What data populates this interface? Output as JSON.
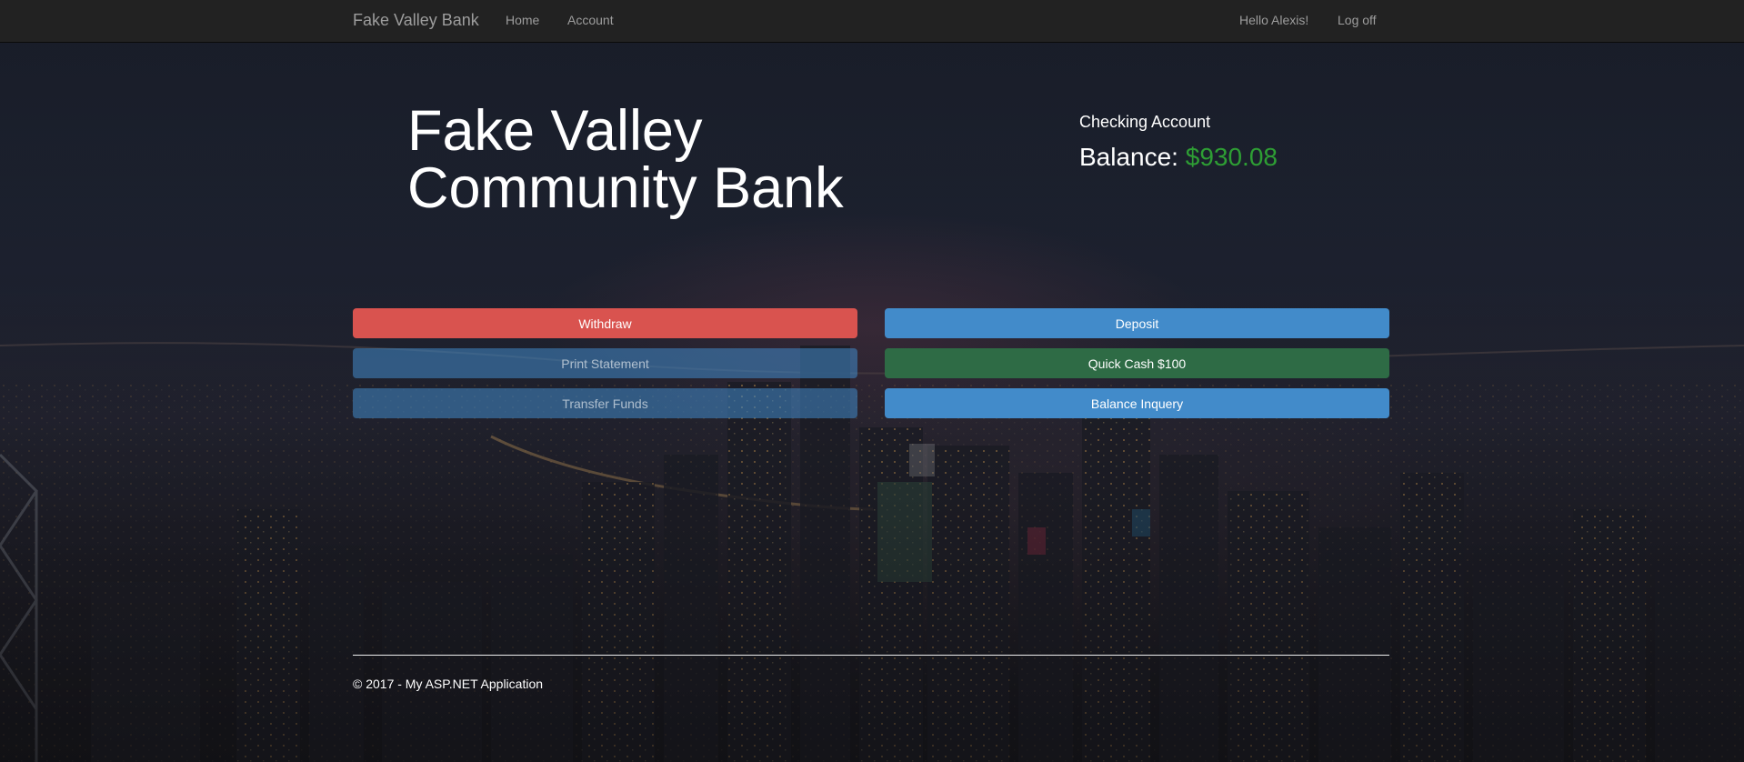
{
  "navbar": {
    "brand": "Fake Valley Bank",
    "links": [
      {
        "label": "Home"
      },
      {
        "label": "Account"
      }
    ],
    "greeting": "Hello Alexis!",
    "logoff": "Log off"
  },
  "hero": {
    "title_line1": "Fake Valley",
    "title_line2": "Community Bank"
  },
  "account": {
    "type": "Checking Account",
    "balance_label": "Balance:",
    "balance_value": "$930.08",
    "balance_color": "#2e9e34"
  },
  "actions": {
    "withdraw": "Withdraw",
    "deposit": "Deposit",
    "print_statement": "Print Statement",
    "quick_cash": "Quick Cash $100",
    "transfer_funds": "Transfer Funds",
    "balance_inquiry": "Balance Inquery"
  },
  "colors": {
    "danger": "#d9534f",
    "primary": "#428bca",
    "success": "#2e6b45",
    "navbar": "#222222"
  },
  "footer": {
    "text": "© 2017 - My ASP.NET Application"
  }
}
